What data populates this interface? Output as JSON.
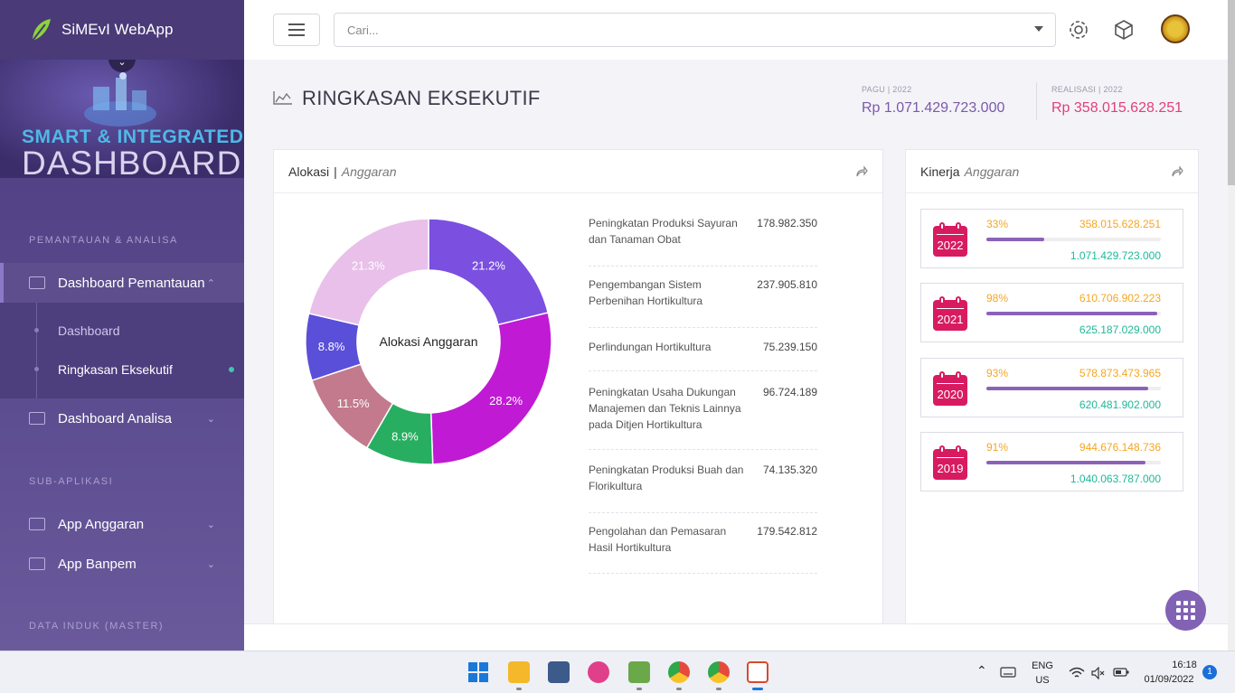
{
  "app": {
    "name": "SiMEvI WebApp",
    "hero_title_top": "SMART & INTEGRATED",
    "hero_title_bottom": "DASHBOARD"
  },
  "sidebar": {
    "section_monitoring": "PEMANTAUAN & ANALISA",
    "dashboard_pemantauan": "Dashboard Pemantauan",
    "sub_dashboard": "Dashboard",
    "sub_ringkasan": "Ringkasan Eksekutif",
    "dashboard_analisa": "Dashboard Analisa",
    "section_subapp": "SUB-APLIKASI",
    "app_anggaran": "App Anggaran",
    "app_banpem": "App Banpem",
    "section_master": "DATA INDUK (MASTER)"
  },
  "topbar": {
    "search_placeholder": "Cari...",
    "icons": [
      "menu-icon",
      "gear-icon",
      "box-icon",
      "ministry-logo"
    ]
  },
  "header": {
    "title": "RINGKASAN EKSEKUTIF",
    "pagu_label": "PAGU | 2022",
    "pagu_value": "Rp 1.071.429.723.000",
    "realisasi_label": "REALISASI | 2022",
    "realisasi_value": "Rp 358.015.628.251",
    "colors": {
      "pagu": "#7a5aa8",
      "realisasi": "#e0407a"
    }
  },
  "alokasi": {
    "title": "Alokasi",
    "subtitle": "Anggaran",
    "center_label": "Alokasi Anggaran",
    "items": [
      {
        "label": "Peningkatan Produksi Sayuran dan Tanaman Obat",
        "value": "178.982.350"
      },
      {
        "label": "Pengembangan Sistem Perbenihan Hortikultura",
        "value": "237.905.810"
      },
      {
        "label": "Perlindungan Hortikultura",
        "value": "75.239.150"
      },
      {
        "label": "Peningkatan Usaha Dukungan Manajemen dan Teknis Lainnya pada Ditjen Hortikultura",
        "value": "96.724.189"
      },
      {
        "label": "Peningkatan Produksi Buah dan Florikultura",
        "value": "74.135.320"
      },
      {
        "label": "Pengolahan dan Pemasaran Hasil Hortikultura",
        "value": "179.542.812"
      }
    ]
  },
  "chart_data": {
    "type": "pie",
    "title": "Alokasi Anggaran",
    "categories": [
      "21.2%",
      "28.2%",
      "8.9%",
      "11.5%",
      "8.8%",
      "21.3%"
    ],
    "values": [
      21.2,
      28.2,
      8.9,
      11.5,
      8.8,
      21.3
    ],
    "labels": [
      "21.2%",
      "28.2%",
      "8.9%",
      "11.5%",
      "8.8%",
      "21.3%"
    ],
    "colors": [
      "#7b4fe0",
      "#c01ad4",
      "#27ae60",
      "#c27a8c",
      "#5a4fd8",
      "#e8c0ea"
    ]
  },
  "kinerja": {
    "title": "Kinerja",
    "subtitle": "Anggaran",
    "rows": [
      {
        "year": "2022",
        "pct": "33%",
        "fill": 0.33,
        "realisasi": "358.015.628.251",
        "pagu": "1.071.429.723.000"
      },
      {
        "year": "2021",
        "pct": "98%",
        "fill": 0.98,
        "realisasi": "610.706.902.223",
        "pagu": "625.187.029.000"
      },
      {
        "year": "2020",
        "pct": "93%",
        "fill": 0.93,
        "realisasi": "578.873.473.965",
        "pagu": "620.481.902.000"
      },
      {
        "year": "2019",
        "pct": "91%",
        "fill": 0.91,
        "realisasi": "944.676.148.736",
        "pagu": "1.040.063.787.000"
      }
    ]
  },
  "taskbar": {
    "lang_top": "ENG",
    "lang_bottom": "US",
    "time": "16:18",
    "date": "01/09/2022",
    "notifications": "1"
  }
}
